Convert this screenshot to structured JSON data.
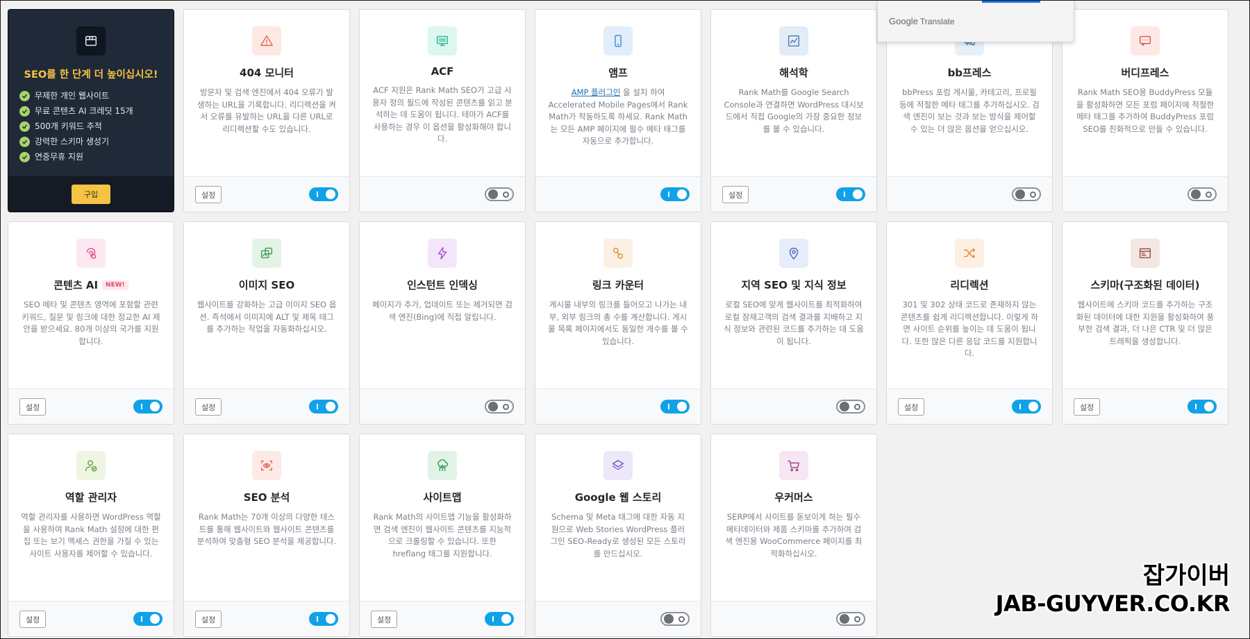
{
  "promo": {
    "title": "SEO를 한 단계 더 높이십시오!",
    "features": [
      "무제한 개인 웹사이트",
      "무료 콘텐츠 AI 크레딧 15개",
      "500개 키워드 추적",
      "강력한 스키마 생성기",
      "연중무휴 지원"
    ],
    "buy_label": "구입"
  },
  "settings_label": "설정",
  "new_badge": "NEW!",
  "modules": [
    {
      "title": "404 모니터",
      "desc": "방문자 및 검색 엔진에서 404 오류가 발생하는 URL을 기록합니다. 리디렉션을 켜서 오류를 유발하는 URL을 다른 URL로 리디렉션할 수도 있습니다.",
      "icon": "warning-icon",
      "icon_bg": "#fde8e4",
      "icon_color": "#e8604c",
      "settings": true,
      "enabled": true
    },
    {
      "title": "ACF",
      "desc": "ACF 지원은 Rank Math SEO가 고급 사용자 정의 필드에 작성된 콘텐츠를 읽고 분석하는 데 도움이 됩니다. 테마가 ACF를 사용하는 경우 이 옵션을 활성화해야 합니다.",
      "icon": "monitor-icon",
      "icon_bg": "#dcf7ef",
      "icon_color": "#27b48a",
      "settings": false,
      "enabled": false
    },
    {
      "title": "앰프",
      "desc_link": "AMP 플러그인",
      "desc": " 을 설치 하여 Accelerated Mobile Pages에서 Rank Math가 작동하도록 하세요. Rank Math는 모든 AMP 페이지에 필수 메타 태그를 자동으로 추가합니다.",
      "icon": "mobile-icon",
      "icon_bg": "#e1eefa",
      "icon_color": "#3a86d6",
      "settings": false,
      "enabled": true
    },
    {
      "title": "해석학",
      "desc": "Rank Math를 Google Search Console과 연결하면 WordPress 대시보드에서 직접 Google의 가장 중요한 정보를 볼 수 있습니다.",
      "icon": "chart-icon",
      "icon_bg": "#e2ecf7",
      "icon_color": "#4c78b0",
      "settings": true,
      "enabled": true
    },
    {
      "title": "bb프레스",
      "desc": "bbPress 포럼 게시물, 카테고리, 프로필 등에 적절한 메타 태그를 추가하십시오. 검색 엔진이 보는 것과 보는 방식을 제어할 수 있는 더 많은 옵션을 얻으십시오.",
      "icon": "forum-icon",
      "icon_bg": "#e6f0f9",
      "icon_color": "#4a82c0",
      "settings": false,
      "enabled": false
    },
    {
      "title": "버디프레스",
      "desc": "Rank Math SEO용 BuddyPress 모듈을 활성화하면 모든 포럼 페이지에 적절한 메타 태그를 추가하여 BuddyPress 포럼 SEO를 친화적으로 만들 수 있습니다.",
      "icon": "chat-icon",
      "icon_bg": "#fde8e4",
      "icon_color": "#d9534f",
      "settings": false,
      "enabled": false
    },
    {
      "title": "콘텐츠 AI",
      "new": true,
      "desc": "SEO 메타 및 콘텐츠 영역에 포함할 관련 키워드, 질문 및 링크에 대한 정교한 AI 제안을 받으세요. 80개 이상의 국가를 지원합니다.",
      "icon": "fingerprint-icon",
      "icon_bg": "#fde8f1",
      "icon_color": "#d9468a",
      "settings": true,
      "enabled": true
    },
    {
      "title": "이미지 SEO",
      "desc": "웹사이트를 강화하는 고급 이미지 SEO 옵션. 즉석에서 이미지에 ALT 및 제목 태그를 추가하는 작업을 자동화하십시오.",
      "icon": "image-icon",
      "icon_bg": "#e3f4e6",
      "icon_color": "#3f9b57",
      "settings": true,
      "enabled": true
    },
    {
      "title": "인스턴트 인덱싱",
      "desc": "페이지가 추가, 업데이트 또는 제거되면 검색 엔진(Bing)에 직접 알립니다.",
      "icon": "bolt-icon",
      "icon_bg": "#f4e6fa",
      "icon_color": "#a24ccc",
      "settings": false,
      "enabled": false
    },
    {
      "title": "링크 카운터",
      "desc": "게시물 내부의 링크를 들어오고 나가는 내부, 외부 링크의 총 수를 계산합니다. 게시물 목록 페이지에서도 동일한 개수를 볼 수 있습니다.",
      "icon": "link-icon",
      "icon_bg": "#fcf0e3",
      "icon_color": "#d98b3a",
      "settings": false,
      "enabled": true
    },
    {
      "title": "지역 SEO 및 지식 정보",
      "desc": "로컬 SEO에 맞게 웹사이트를 최적화하여 로컬 잠재고객의 검색 결과를 지배하고 지식 정보와 관련된 코드를 추가하는 데 도움이 됩니다.",
      "icon": "location-icon",
      "icon_bg": "#e7ecfa",
      "icon_color": "#4a5fc1",
      "settings": false,
      "enabled": false
    },
    {
      "title": "리디렉션",
      "desc": "301 및 302 상태 코드로 존재하지 않는 콘텐츠를 쉽게 리디렉션합니다. 이렇게 하면 사이트 순위를 높이는 데 도움이 됩니다. 또한 많은 다른 응답 코드를 지원합니다.",
      "icon": "shuffle-icon",
      "icon_bg": "#fdf0e3",
      "icon_color": "#e08a2e",
      "settings": true,
      "enabled": true
    },
    {
      "title": "스키마(구조화된 데이터)",
      "desc": "웹사이트에 스키마 코드를 추가하는 구조화된 데이터에 대한 지원을 활성화하여 풍부한 검색 결과, 더 나은 CTR 및 더 많은 트래픽을 생성합니다.",
      "icon": "schema-icon",
      "icon_bg": "#f3e6e3",
      "icon_color": "#9a4b3c",
      "settings": true,
      "enabled": true
    },
    {
      "title": "역할 관리자",
      "desc": "역할 관리자를 사용하면 WordPress 역할을 사용하여 Rank Math 설정에 대한 편집 또는 보기 액세스 권한을 가질 수 있는 사이트 사용자를 제어할 수 있습니다.",
      "icon": "user-icon",
      "icon_bg": "#eef5e3",
      "icon_color": "#6a9a3a",
      "settings": true,
      "enabled": true
    },
    {
      "title": "SEO 분석",
      "desc": "Rank Math는 70개 이상의 다양한 테스트를 통해 웹사이트와 웹사이트 콘텐츠를 분석하여 맞춤형 SEO 분석을 제공합니다.",
      "icon": "eye-icon",
      "icon_bg": "#fde9e6",
      "icon_color": "#e0614f",
      "settings": true,
      "enabled": true
    },
    {
      "title": "사이트맵",
      "desc": "Rank Math의 사이트맵 기능을 활성화하면 검색 엔진이 웹사이트 콘텐츠를 지능적으로 크롤링할 수 있습니다. 또한 hreflang 태그를 지원합니다.",
      "icon": "sitemap-icon",
      "icon_bg": "#e1f3e6",
      "icon_color": "#2e9a55",
      "settings": true,
      "enabled": true
    },
    {
      "title": "Google 웹 스토리",
      "desc": "Schema 및 Meta 태그에 대한 자동 지원으로 Web Stories WordPress 플러그인 SEO-Ready로 생성된 모든 스토리를 만드십시오.",
      "icon": "layers-icon",
      "icon_bg": "#ece8fa",
      "icon_color": "#6a4fc9",
      "settings": false,
      "enabled": false
    },
    {
      "title": "우커머스",
      "desc": "SERP에서 사이트를 돋보이게 하는 필수 메타데이터와 제품 스키마를 추가하여 검색 엔진용 WooCommerce 페이지를 최적화하십시오.",
      "icon": "cart-icon",
      "icon_bg": "#f6e6f2",
      "icon_color": "#a33c86",
      "settings": false,
      "enabled": false
    }
  ],
  "translate_popup": {
    "brand": "Google",
    "label": "Translate"
  },
  "watermark": {
    "line1": "잡가이버",
    "line2": "JAB-GUYVER.CO.KR"
  }
}
